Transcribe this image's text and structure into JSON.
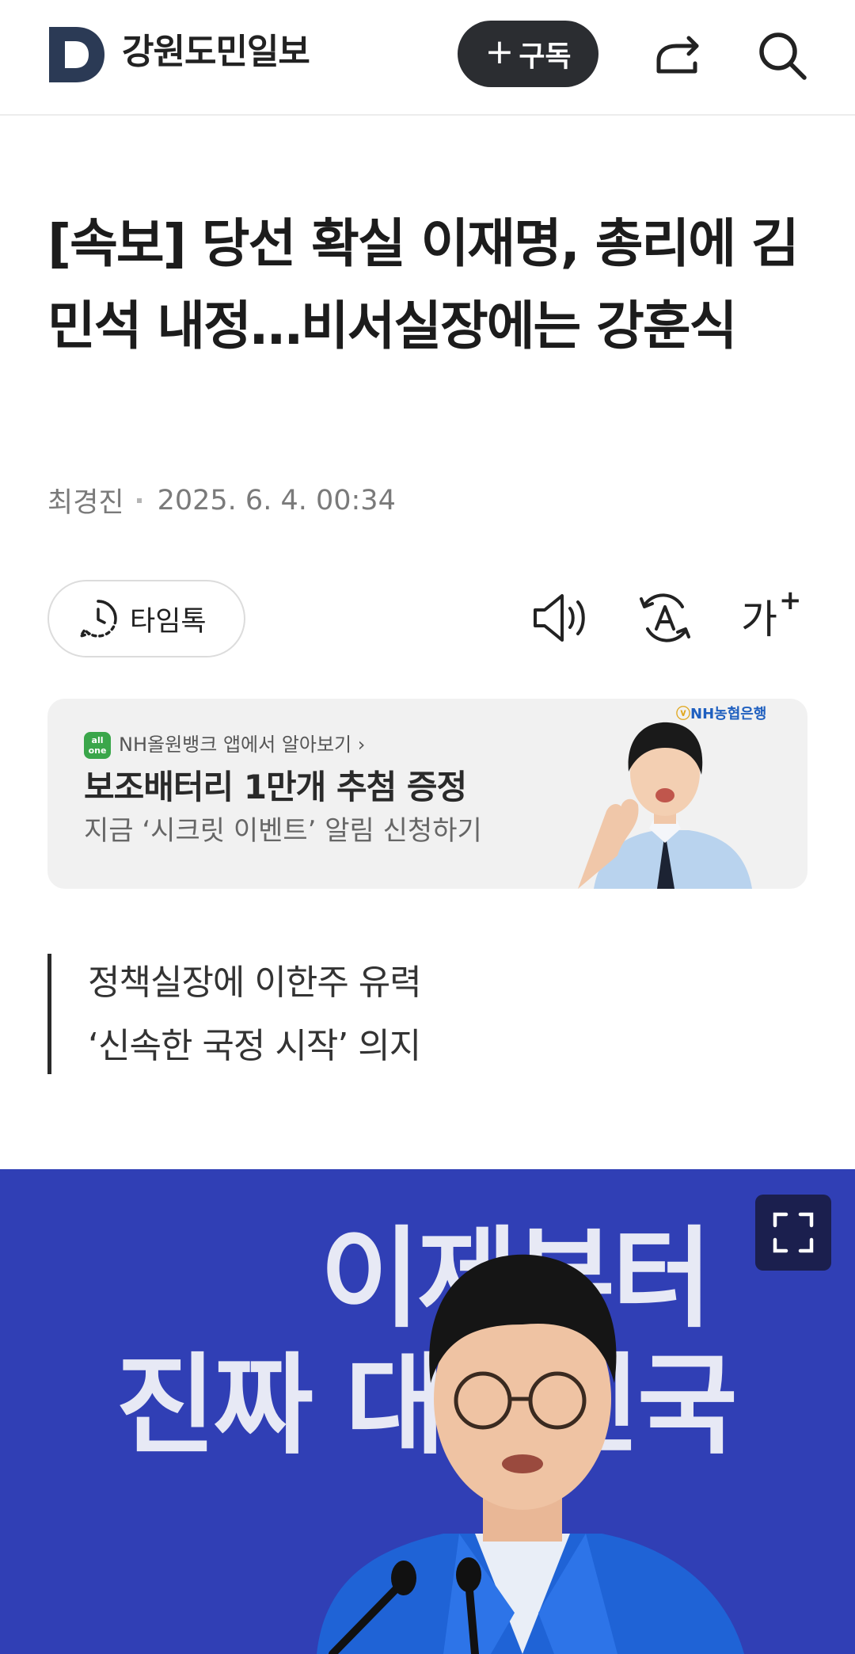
{
  "header": {
    "logo_letter": "D",
    "brand_name": "강원도민일보",
    "subscribe_label": "구독",
    "icons": [
      "share-icon",
      "search-icon"
    ]
  },
  "article": {
    "title": "[속보] 당선 확실 이재명, 총리에 김민석 내정…비서실장에는 강훈식",
    "author": "최경진",
    "date": "2025. 6. 4. 00:34"
  },
  "toolbar": {
    "timetalk_label": "타임톡",
    "font_size_label": "가",
    "font_size_plus": "+",
    "icons": [
      "speaker-icon",
      "translate-icon",
      "font-size-icon"
    ]
  },
  "ad": {
    "badge_line1": "all",
    "badge_line2": "one",
    "source": "NH올원뱅크 앱에서 알아보기 ›",
    "headline": "보조배터리 1만개 추첨 증정",
    "subtext": "지금 ‘시크릿 이벤트’ 알림 신청하기",
    "bank_name": "NH농협은행"
  },
  "summary": {
    "lines": [
      "정책실장에 이한주 유력",
      "‘신속한 국정 시작’ 의지"
    ]
  },
  "photo": {
    "banner_line1": "이제부터",
    "banner_line2": "진짜 대한민국",
    "expand_icon": "expand-icon"
  },
  "colors": {
    "brand_dark": "#2b3a55",
    "subscribe_bg": "#2b2d31",
    "photo_bg": "#2f3cae"
  }
}
